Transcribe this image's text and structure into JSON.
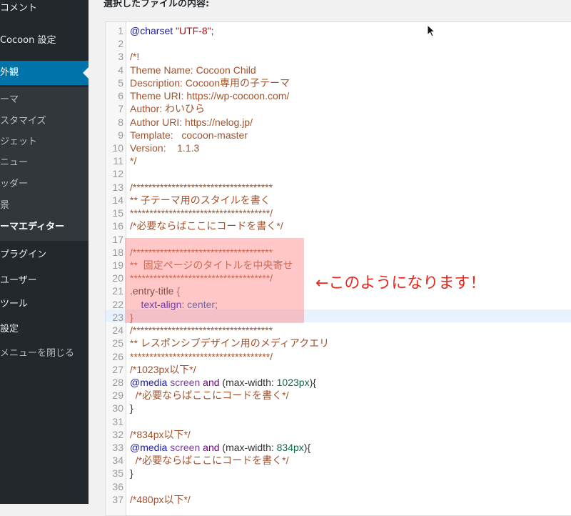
{
  "sidebar": {
    "top_items": [
      {
        "label": "コメント"
      },
      {
        "label": "Cocoon 設定"
      },
      {
        "label": "外観"
      }
    ],
    "sub_items": [
      {
        "label": "ーマ"
      },
      {
        "label": "スタマイズ"
      },
      {
        "label": "ジェット"
      },
      {
        "label": "ニュー"
      },
      {
        "label": "ッダー"
      },
      {
        "label": "景"
      },
      {
        "label": "ーマエディター"
      }
    ],
    "bottom_items": [
      {
        "label": "プラグイン"
      },
      {
        "label": "ユーザー"
      },
      {
        "label": "ツール"
      },
      {
        "label": "設定"
      },
      {
        "label": "メニューを閉じる"
      }
    ]
  },
  "main": {
    "heading": "選択したファイルの内容:",
    "annotation": "←このようになります！"
  },
  "colors": {
    "sidebar_bg": "#23282d",
    "active": "#0073aa",
    "annotation": "#e8281e",
    "highlight": "#ff8282"
  },
  "code_lines": [
    {
      "n": "1",
      "parts": [
        {
          "t": "@charset ",
          "c": "at"
        },
        {
          "t": "\"UTF-8\"",
          "c": "string"
        },
        {
          "t": ";",
          "c": "punct"
        }
      ]
    },
    {
      "n": "2",
      "parts": []
    },
    {
      "n": "3",
      "parts": [
        {
          "t": "/*!",
          "c": "comment"
        }
      ]
    },
    {
      "n": "4",
      "parts": [
        {
          "t": "Theme Name: Cocoon Child",
          "c": "comment"
        }
      ]
    },
    {
      "n": "5",
      "parts": [
        {
          "t": "Description: Cocoon専用の子テーマ",
          "c": "comment"
        }
      ]
    },
    {
      "n": "6",
      "parts": [
        {
          "t": "Theme URI: https://wp-cocoon.com/",
          "c": "comment"
        }
      ]
    },
    {
      "n": "7",
      "parts": [
        {
          "t": "Author: わいひら",
          "c": "comment"
        }
      ]
    },
    {
      "n": "8",
      "parts": [
        {
          "t": "Author URI: https://nelog.jp/",
          "c": "comment"
        }
      ]
    },
    {
      "n": "9",
      "parts": [
        {
          "t": "Template:   cocoon-master",
          "c": "comment"
        }
      ]
    },
    {
      "n": "10",
      "parts": [
        {
          "t": "Version:    1.1.3",
          "c": "comment"
        }
      ]
    },
    {
      "n": "11",
      "parts": [
        {
          "t": "*/",
          "c": "comment"
        }
      ]
    },
    {
      "n": "12",
      "parts": []
    },
    {
      "n": "13",
      "parts": [
        {
          "t": "/************************************",
          "c": "comment"
        }
      ]
    },
    {
      "n": "14",
      "parts": [
        {
          "t": "** 子テーマ用のスタイルを書く",
          "c": "comment"
        }
      ]
    },
    {
      "n": "15",
      "parts": [
        {
          "t": "************************************/",
          "c": "comment"
        }
      ]
    },
    {
      "n": "16",
      "parts": [
        {
          "t": "/*必要ならばここにコードを書く*/",
          "c": "comment"
        }
      ]
    },
    {
      "n": "17",
      "parts": []
    },
    {
      "n": "18",
      "parts": [
        {
          "t": "/************************************",
          "c": "comment"
        }
      ]
    },
    {
      "n": "19",
      "parts": [
        {
          "t": "**  固定ページのタイトルを中央寄せ",
          "c": "comment"
        }
      ]
    },
    {
      "n": "20",
      "parts": [
        {
          "t": "************************************/",
          "c": "comment"
        }
      ]
    },
    {
      "n": "21",
      "parts": [
        {
          "t": ".entry-title ",
          "c": "plain"
        },
        {
          "t": "{",
          "c": "comment"
        }
      ]
    },
    {
      "n": "22",
      "parts": [
        {
          "t": "    text-align",
          "c": "property"
        },
        {
          "t": ": ",
          "c": "punct"
        },
        {
          "t": "center",
          "c": "value"
        },
        {
          "t": ";",
          "c": "punct"
        }
      ]
    },
    {
      "n": "23",
      "parts": [
        {
          "t": "}",
          "c": "comment"
        }
      ]
    },
    {
      "n": "24",
      "parts": [
        {
          "t": "/************************************",
          "c": "comment"
        }
      ]
    },
    {
      "n": "25",
      "parts": [
        {
          "t": "** レスポンシブデザイン用のメディアクエリ",
          "c": "comment"
        }
      ]
    },
    {
      "n": "26",
      "parts": [
        {
          "t": "************************************/",
          "c": "comment"
        }
      ]
    },
    {
      "n": "27",
      "parts": [
        {
          "t": "/*1023px以下*/",
          "c": "comment"
        }
      ]
    },
    {
      "n": "28",
      "parts": [
        {
          "t": "@media ",
          "c": "at"
        },
        {
          "t": "screen ",
          "c": "atrule"
        },
        {
          "t": "and ",
          "c": "keyword"
        },
        {
          "t": "(max-width: ",
          "c": "punct"
        },
        {
          "t": "1023px",
          "c": "number"
        },
        {
          "t": "){",
          "c": "punct"
        }
      ]
    },
    {
      "n": "29",
      "parts": [
        {
          "t": "  /*必要ならばここにコードを書く*/",
          "c": "comment"
        }
      ]
    },
    {
      "n": "30",
      "parts": [
        {
          "t": "}",
          "c": "punct"
        }
      ]
    },
    {
      "n": "31",
      "parts": []
    },
    {
      "n": "32",
      "parts": [
        {
          "t": "/*834px以下*/",
          "c": "comment"
        }
      ]
    },
    {
      "n": "33",
      "parts": [
        {
          "t": "@media ",
          "c": "at"
        },
        {
          "t": "screen ",
          "c": "atrule"
        },
        {
          "t": "and ",
          "c": "keyword"
        },
        {
          "t": "(max-width: ",
          "c": "punct"
        },
        {
          "t": "834px",
          "c": "number"
        },
        {
          "t": "){",
          "c": "punct"
        }
      ]
    },
    {
      "n": "34",
      "parts": [
        {
          "t": "  /*必要ならばここにコードを書く*/",
          "c": "comment"
        }
      ]
    },
    {
      "n": "35",
      "parts": [
        {
          "t": "}",
          "c": "punct"
        }
      ]
    },
    {
      "n": "36",
      "parts": []
    },
    {
      "n": "37",
      "parts": [
        {
          "t": "/*480px以下*/",
          "c": "comment"
        }
      ]
    }
  ]
}
